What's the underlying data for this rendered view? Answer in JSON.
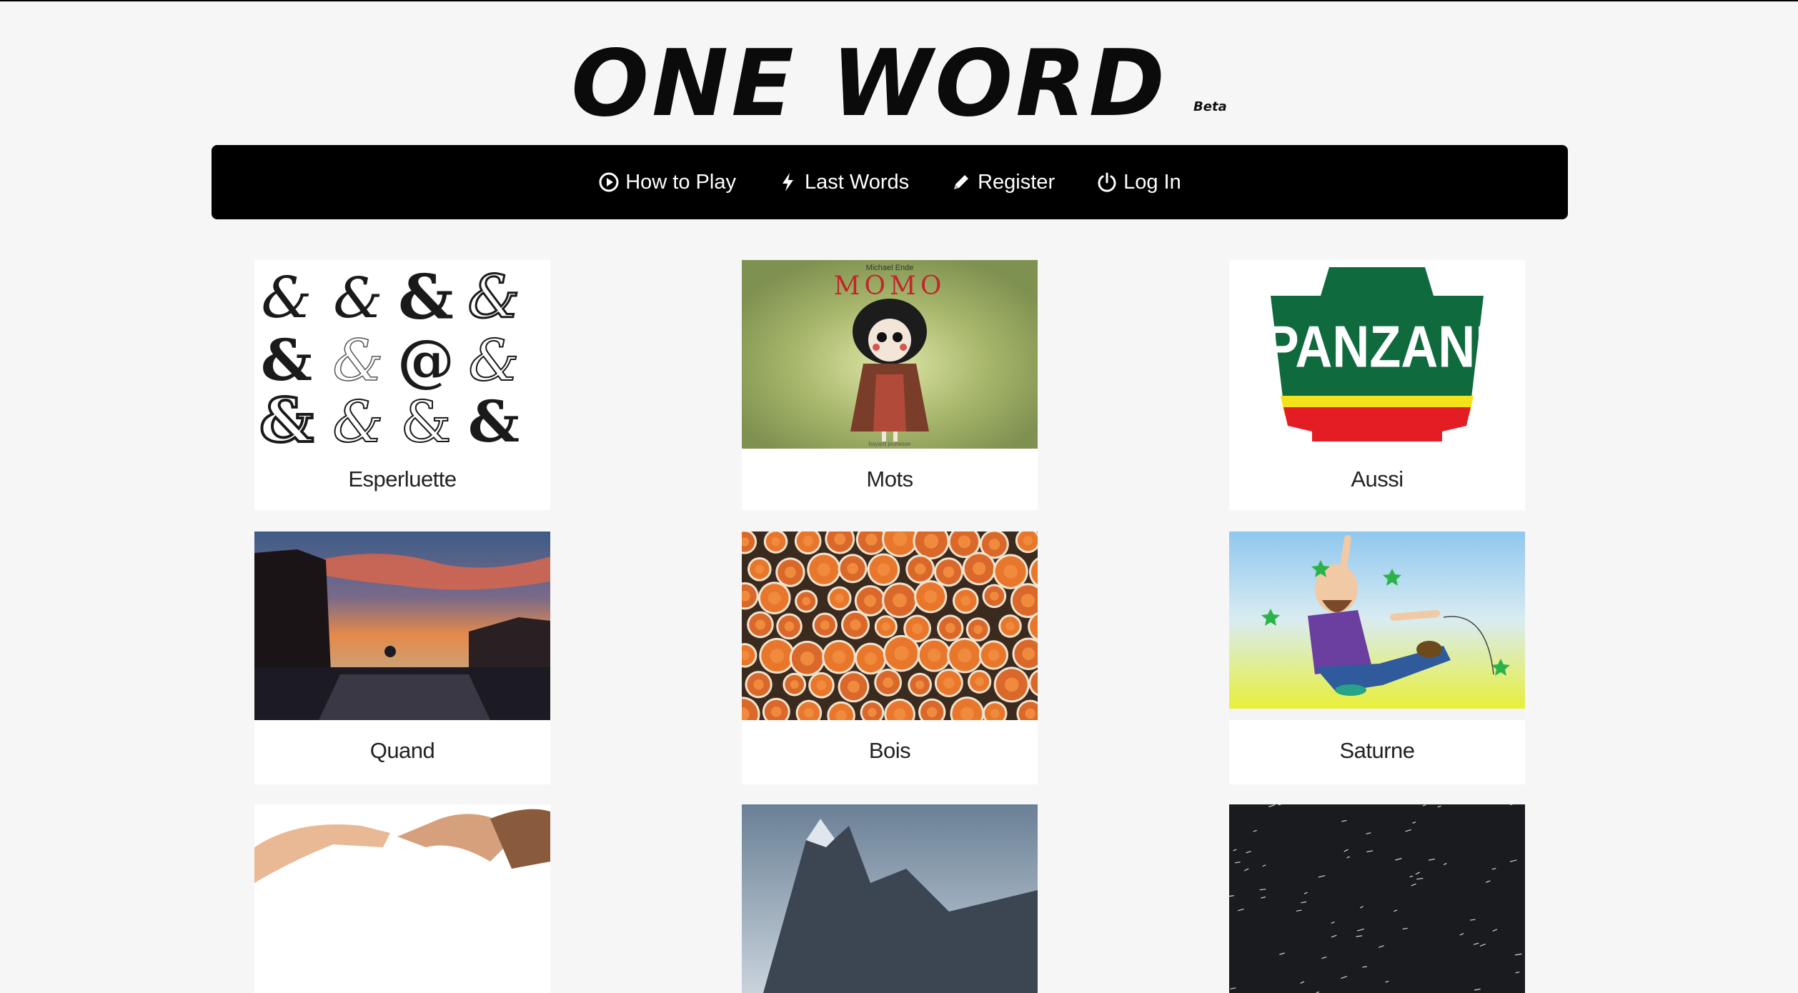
{
  "header": {
    "logo": "One Word",
    "badge": "Beta"
  },
  "nav": [
    {
      "label": "How to Play",
      "icon": "play-circle-icon"
    },
    {
      "label": "Last Words",
      "icon": "bolt-icon"
    },
    {
      "label": "Register",
      "icon": "pencil-icon"
    },
    {
      "label": "Log In",
      "icon": "power-icon"
    }
  ],
  "cards": [
    {
      "word": "Esperluette",
      "image": "ampersands"
    },
    {
      "word": "Mots",
      "image": "momo-book-cover"
    },
    {
      "word": "Aussi",
      "image": "panzani-logo"
    },
    {
      "word": "Quand",
      "image": "sunset-street"
    },
    {
      "word": "Bois",
      "image": "log-pile"
    },
    {
      "word": "Saturne",
      "image": "cartoon-dizzy-man"
    },
    {
      "word": "",
      "image": "joined-hands"
    },
    {
      "word": "",
      "image": "mountain-peaks"
    },
    {
      "word": "",
      "image": "night-sky-stars"
    }
  ],
  "image_text": {
    "momo_author": "Michael Ende",
    "momo_title": "MOMO",
    "panzani": "PANZANI"
  },
  "colors": {
    "navbar": "#000000",
    "page_bg": "#f6f6f6",
    "panzani_green": "#0f6b3e",
    "panzani_red": "#e31d23"
  }
}
